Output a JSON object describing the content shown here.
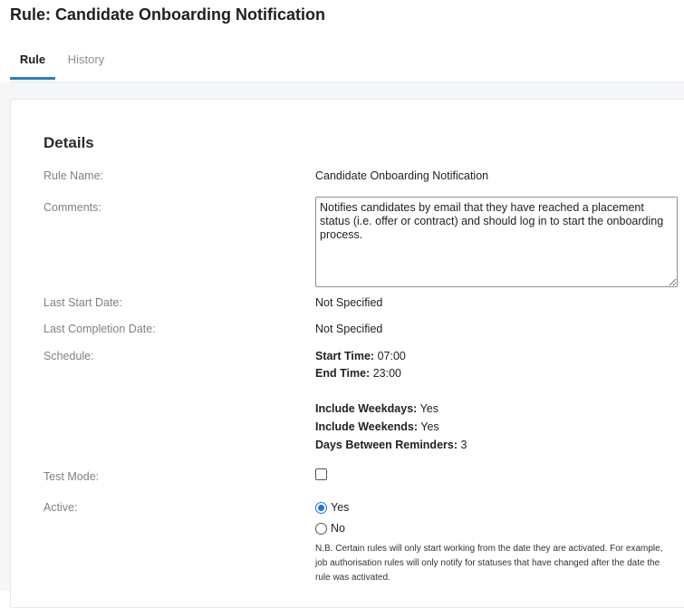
{
  "page": {
    "title": "Rule: Candidate Onboarding Notification"
  },
  "tabs": [
    {
      "label": "Rule",
      "active": true
    },
    {
      "label": "History",
      "active": false
    }
  ],
  "details": {
    "heading": "Details",
    "rule_name_label": "Rule Name:",
    "rule_name_value": "Candidate Onboarding Notification",
    "comments_label": "Comments:",
    "comments_value": "Notifies candidates by email that they have reached a placement status (i.e. offer or contract) and should log in to start the onboarding process.",
    "last_start_label": "Last Start Date:",
    "last_start_value": "Not Specified",
    "last_completion_label": "Last Completion Date:",
    "last_completion_value": "Not Specified",
    "schedule_label": "Schedule:",
    "schedule": {
      "start_time_label": "Start Time:",
      "start_time_value": "07:00",
      "end_time_label": "End Time:",
      "end_time_value": "23:00",
      "weekdays_label": "Include Weekdays:",
      "weekdays_value": "Yes",
      "weekends_label": "Include Weekends:",
      "weekends_value": "Yes",
      "days_between_label": "Days Between Reminders:",
      "days_between_value": "3"
    },
    "test_mode_label": "Test Mode:",
    "test_mode_checked": false,
    "active_label": "Active:",
    "active_options": [
      {
        "label": "Yes",
        "checked": true
      },
      {
        "label": "No",
        "checked": false
      }
    ],
    "note": "N.B. Certain rules will only start working from the date they are activated. For example, job authorisation rules will only notify for statuses that have changed after the date the rule was activated."
  },
  "colors": {
    "accent": "#2f7ec1",
    "radio_selected": "#1a73e8",
    "label_gray": "#7d8287",
    "band_gray": "#f4f6f8"
  }
}
